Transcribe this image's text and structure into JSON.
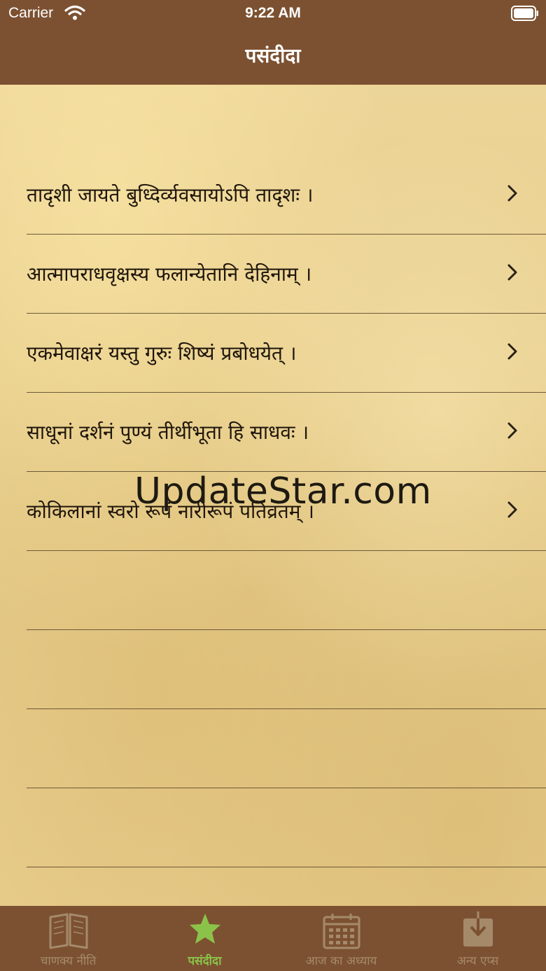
{
  "status_bar": {
    "carrier": "Carrier",
    "time": "9:22 AM"
  },
  "nav": {
    "title": "पसंदीदा"
  },
  "rows": [
    {
      "text": "तादृशी जायते बुध्दिर्व्यवसायोऽपि तादृशः ।"
    },
    {
      "text": "आत्मापराधवृक्षस्य फलान्येतानि देहिनाम् ।"
    },
    {
      "text": "एकमेवाक्षरं यस्तु गुरुः शिष्यं प्रबोधयेत् ।"
    },
    {
      "text": "साधूनां दर्शनं पुण्यं तीर्थीभूता हि साधवः ।"
    },
    {
      "text": "कोकिलानां स्वरो रूपं नारीरूपं पतिव्रतम् ।"
    }
  ],
  "watermark": "UpdateStar.com",
  "tabs": [
    {
      "label": "चाणक्य नीति",
      "icon": "book-icon",
      "active": false
    },
    {
      "label": "पसंदीदा",
      "icon": "star-icon",
      "active": true
    },
    {
      "label": "आज का अध्याय",
      "icon": "calendar-icon",
      "active": false
    },
    {
      "label": "अन्य एप्स",
      "icon": "download-icon",
      "active": false
    }
  ],
  "colors": {
    "bar": "#7c5131",
    "active_tab": "#8bc34a",
    "inactive_tab": "#a58a6a",
    "paper": "#e6cf95"
  }
}
